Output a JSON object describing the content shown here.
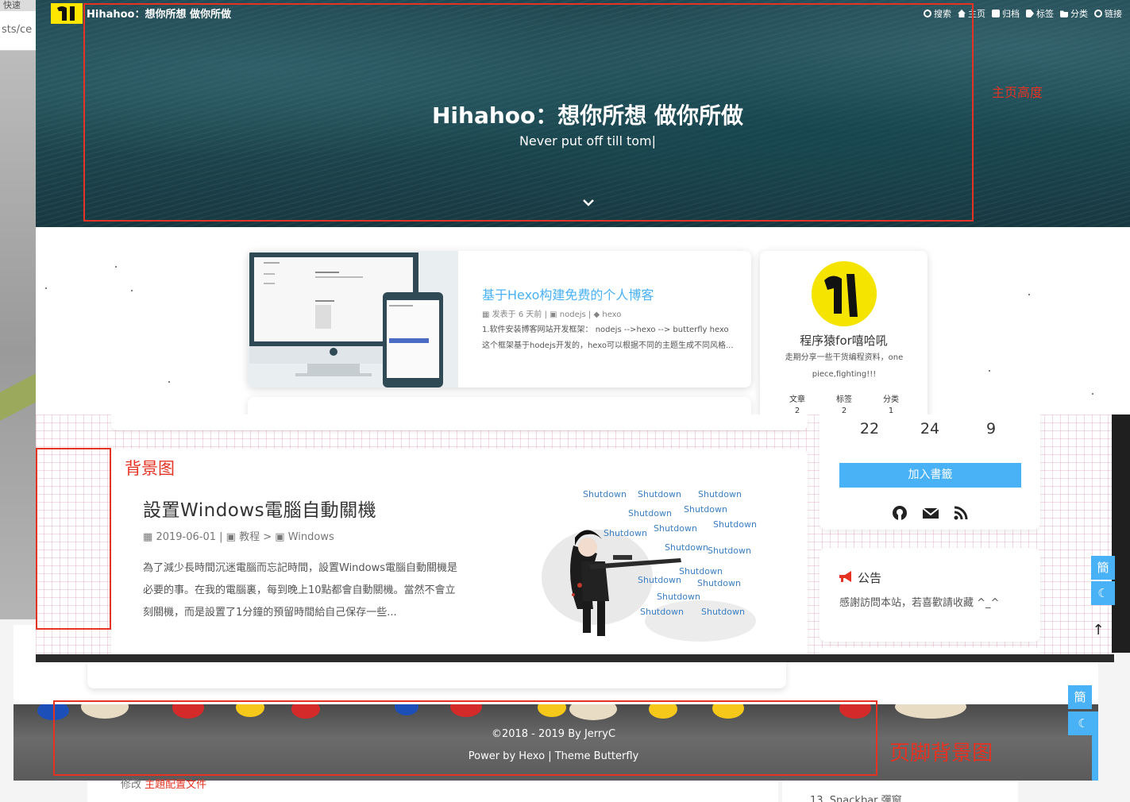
{
  "browser": {
    "tab_fragment": "快速",
    "url_fragment": "sts/ce"
  },
  "hero": {
    "blog_name": "Hihahoo：想你所想 做你所做",
    "title": "Hihahoo：想你所想 做你所做",
    "subtitle": "Never put off till tom|",
    "nav": [
      {
        "label": "搜索",
        "icon": "search-icon"
      },
      {
        "label": "主页",
        "icon": "home-icon"
      },
      {
        "label": "归档",
        "icon": "archive-icon"
      },
      {
        "label": "标签",
        "icon": "tag-icon"
      },
      {
        "label": "分类",
        "icon": "folder-icon"
      },
      {
        "label": "链接",
        "icon": "link-icon"
      }
    ]
  },
  "annotations": {
    "home_height": "主页高度",
    "background_image": "背景图",
    "footer_background": "页脚背景图"
  },
  "top_post": {
    "title": "基于Hexo构建免费的个人博客",
    "meta_date": "发表于 6 天前",
    "meta_category": "nodejs",
    "meta_tag": "hexo",
    "excerpt": "1.软件安装博客网站开发框架： nodejs -->hexo --> butterfly hexo这个框架基于hodejs开发的，hexo可以根据不同的主题生成不同风格..."
  },
  "profile": {
    "name": "程序猿for嘻哈吼",
    "description": "走期分享一些干货编程资料，one piece,fighting!!!",
    "stats": [
      {
        "label": "文章",
        "value": "2"
      },
      {
        "label": "标签",
        "value": "2"
      },
      {
        "label": "分类",
        "value": "1"
      }
    ]
  },
  "mid_post": {
    "title": "設置Windows電腦自動關機",
    "date": "2019-06-01",
    "category": "教程",
    "subcategory": "Windows",
    "excerpt": "為了減少長時間沉迷電腦而忘記時間，設置Windows電腦自動關機是必要的事。在我的電腦裏，每到晚上10點都會自動關機。當然不會立刻關機，而是設置了1分鐘的預留時間給自己保存一些...",
    "illustration_word": "Shutdown"
  },
  "mid_sidebar": {
    "stats": [
      "22",
      "24",
      "9"
    ],
    "bookmark_button": "加入書籤",
    "notice_title": "公告",
    "notice_text": "感謝訪問本站，若喜歡請收藏 ^_^"
  },
  "float_buttons": {
    "simplified": "簡",
    "dark_mode": "☾",
    "back_to_top": "↑"
  },
  "footer": {
    "copyright": "©2018 - 2019 By JerryC",
    "powered": "Power by Hexo | Theme Butterfly"
  },
  "below_footer": {
    "text_prefix": "修改",
    "text_link": "主題配置文件",
    "right_text": "13. Snackbar 彈窗"
  },
  "colors": {
    "accent": "#49b1f5",
    "annotation": "#e53222",
    "logo": "#ffe600"
  }
}
